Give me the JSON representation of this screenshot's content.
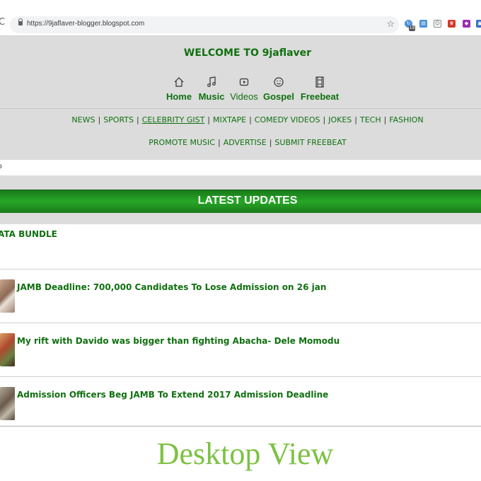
{
  "browser": {
    "url": "https://9jaflaver-blogger.blogspot.com",
    "reload_icon": "reload-icon",
    "star_icon": "bookmark-star-icon",
    "extensions": [
      {
        "name": "extension-sync-icon",
        "color": "#4a90d9",
        "badge": "19"
      },
      {
        "name": "extension-fire-icon",
        "color": "#4a90d9"
      },
      {
        "name": "extension-bot-icon",
        "color": "#777777"
      },
      {
        "name": "extension-red-icon",
        "color": "#d33b2c"
      },
      {
        "name": "extension-purple-icon",
        "color": "#9b2fae"
      },
      {
        "name": "extension-blue-icon",
        "color": "#3b6fc0"
      }
    ]
  },
  "header": {
    "title": "WELCOME TO 9jaflaver",
    "nav": [
      {
        "label": "Home",
        "icon": "home-icon"
      },
      {
        "label": "Music",
        "icon": "music-note-icon"
      },
      {
        "label": "Videos",
        "icon": "play-icon"
      },
      {
        "label": "Gospel",
        "icon": "smiley-icon"
      },
      {
        "label": "Freebeat",
        "icon": "film-icon"
      }
    ]
  },
  "categories": {
    "row1": [
      "NEWS",
      "SPORTS",
      "CELEBRITY GIST",
      "MIXTAPE",
      "COMEDY VIDEOS",
      "JOKES",
      "TECH",
      "FASHION"
    ],
    "row2": [
      "PROMOTE MUSIC",
      "ADVERTISE",
      "SUBMIT FREEBEAT"
    ],
    "separator": "|"
  },
  "strip_text": "o",
  "updates": {
    "title": "LATEST UPDATES"
  },
  "posts": [
    {
      "title": "ATA BUNDLE"
    },
    {
      "title": "JAMB Deadline: 700,000 Candidates To Lose Admission on 26 jan"
    },
    {
      "title": "My rift with Davido was bigger than fighting Abacha- Dele Momodu"
    },
    {
      "title": "Admission Officers Beg JAMB To Extend 2017 Admission Deadline"
    }
  ],
  "caption": "Desktop View",
  "colors": {
    "brand_green": "#107010",
    "banner_green": "#27a627",
    "caption_green": "#7cc242",
    "header_gray": "#dcdcdc"
  }
}
